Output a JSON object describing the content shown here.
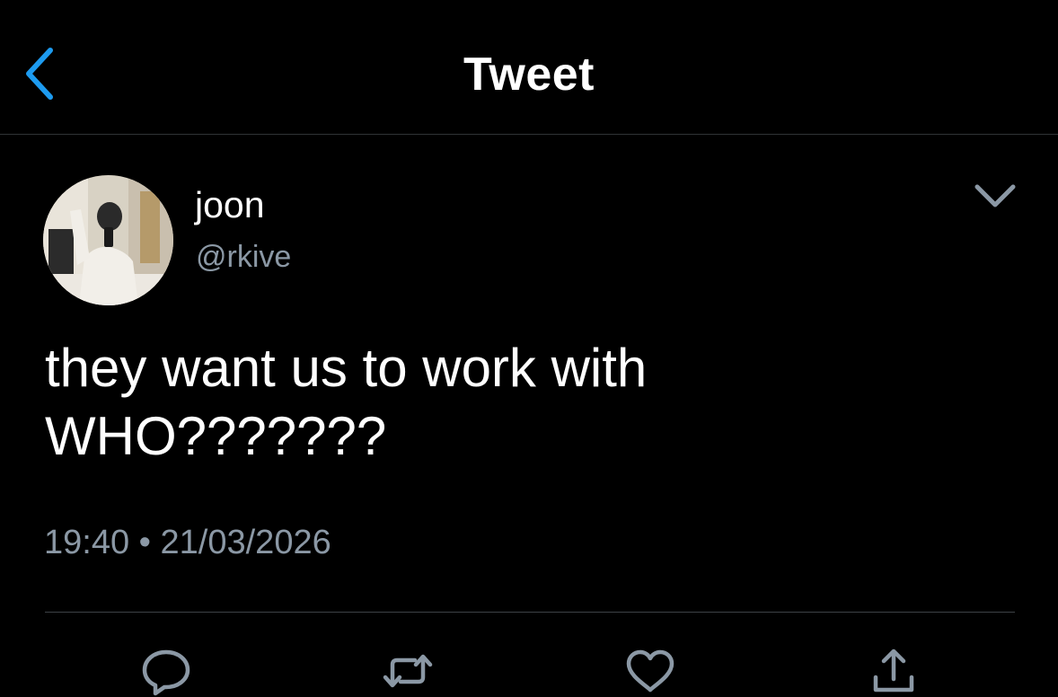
{
  "header": {
    "title": "Tweet",
    "back_icon": "chevron-left-icon"
  },
  "tweet": {
    "author": {
      "display_name": "joon",
      "handle": "@rkive"
    },
    "text_lines": [
      "they want us to work with",
      "WHO???????"
    ],
    "time": "19:40",
    "separator": "•",
    "date": "21/03/2026"
  },
  "actions": {
    "reply_icon": "reply-bubble-icon",
    "retweet_icon": "retweet-icon",
    "like_icon": "heart-icon",
    "share_icon": "share-upload-icon"
  },
  "colors": {
    "background": "#000000",
    "accent": "#1d9bf0",
    "secondary_text": "#8b98a5",
    "icon": "#8b98a5"
  }
}
